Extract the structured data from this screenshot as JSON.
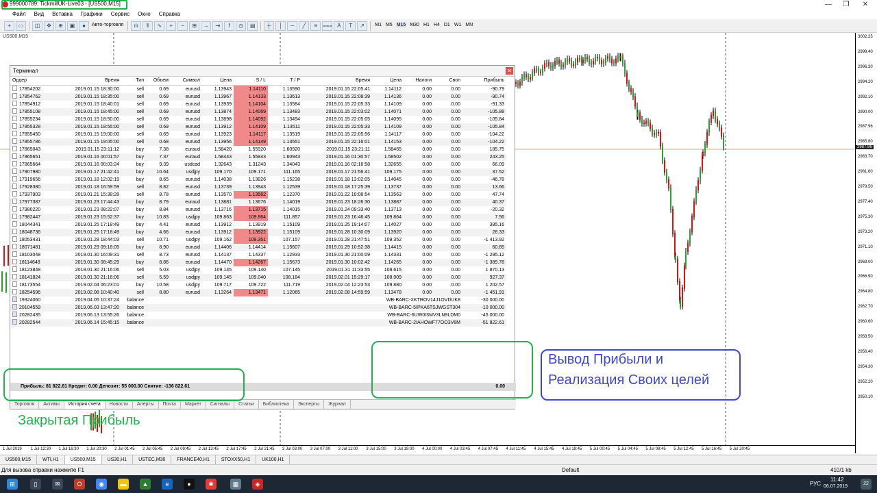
{
  "window": {
    "title": "999000789: TickmillUK-Live03 - [US500,M15]",
    "min": "—",
    "restore": "❐",
    "close": "✕"
  },
  "menu": [
    "Файл",
    "Вид",
    "Вставка",
    "Графики",
    "Сервис",
    "Окно",
    "Справка"
  ],
  "toolbar": {
    "autotrade": "Авто-торговля",
    "timeframes": [
      "M1",
      "M5",
      "M15",
      "M30",
      "H1",
      "H4",
      "D1",
      "W1",
      "MN"
    ]
  },
  "chart": {
    "symbol": "US500,M15",
    "prices": [
      "3002.25",
      "2998.40",
      "2996.30",
      "2994.20",
      "2992.10",
      "2990.00",
      "2987.96",
      "2985.80",
      "2983.70",
      "2981.60",
      "2979.50",
      "2977.40",
      "2975.30",
      "2973.20",
      "2971.10",
      "2969.00",
      "2966.90",
      "2964.80",
      "2962.70",
      "2960.60",
      "2958.50",
      "2956.40",
      "2954.30",
      "2952.20",
      "2950.10"
    ],
    "current_price": "2987.96",
    "times": [
      "1 Jul 2019",
      "1 Jul 12:30",
      "1 Jul 16:30",
      "1 Jul 20:30",
      "2 Jul 01:45",
      "2 Jul 05:45",
      "2 Jul 09:45",
      "2 Jul 13:45",
      "2 Jul 17:45",
      "2 Jul 21:45",
      "3 Jul 03:00",
      "3 Jul 07:00",
      "3 Jul 11:00",
      "3 Jul 15:00",
      "3 Jul 19:00",
      "4 Jul 00:00",
      "4 Jul 03:45",
      "4 Jul 07:45",
      "4 Jul 11:45",
      "4 Jul 15:45",
      "4 Jul 19:45",
      "5 Jul 00:45",
      "5 Jul 04:45",
      "5 Jul 08:45",
      "5 Jul 12:45",
      "5 Jul 16:45",
      "5 Jul 20:45"
    ]
  },
  "terminal": {
    "title": "Терминал",
    "close": "✕",
    "columns": [
      "Ордер",
      "Время",
      "Тип",
      "Объем",
      "Символ",
      "Цена",
      "S / L",
      "T / P",
      "Время",
      "Цена",
      "Налоги",
      "Своп",
      "Прибыль"
    ],
    "trades": [
      [
        "17854202",
        "2019.01.15 18:30:00",
        "sell",
        "0.69",
        "eurusd",
        "1.13943",
        "1.14110",
        "1.13590",
        "2019.01.15 22:05:41",
        "1.14112",
        "0.00",
        "0.00",
        "-90.79"
      ],
      [
        "17854762",
        "2019.01.15 18:35:00",
        "sell",
        "0.69",
        "eurusd",
        "1.13967",
        "1.14133",
        "1.13613",
        "2019.01.15 22:08:39",
        "1.14136",
        "0.00",
        "0.00",
        "-90.74"
      ],
      [
        "17854912",
        "2019.01.15 18:40:01",
        "sell",
        "0.69",
        "eurusd",
        "1.13939",
        "1.14104",
        "1.13584",
        "2019.01.15 22:05:33",
        "1.14109",
        "0.00",
        "0.00",
        "-91.33"
      ],
      [
        "17855108",
        "2019.01.15 18:45:00",
        "sell",
        "0.69",
        "eurusd",
        "1.13874",
        "1.14069",
        "1.13483",
        "2019.01.15 22:03:02",
        "1.14071",
        "0.00",
        "0.00",
        "-105.88"
      ],
      [
        "17855234",
        "2019.01.15 18:50:00",
        "sell",
        "0.69",
        "eurusd",
        "1.13898",
        "1.14092",
        "1.13494",
        "2019.01.15 22:05:05",
        "1.14095",
        "0.00",
        "0.00",
        "-105.84"
      ],
      [
        "17855328",
        "2019.01.15 18:55:00",
        "sell",
        "0.69",
        "eurusd",
        "1.13912",
        "1.14109",
        "1.13511",
        "2019.01.15 22:05:33",
        "1.14109",
        "0.00",
        "0.00",
        "-105.84"
      ],
      [
        "17855450",
        "2019.01.15 19:00:00",
        "sell",
        "0.69",
        "eurusd",
        "1.13923",
        "1.14117",
        "1.13519",
        "2019.01.15 22:05:56",
        "1.14117",
        "0.00",
        "0.00",
        "-104.22"
      ],
      [
        "17855786",
        "2019.01.15 19:05:00",
        "sell",
        "0.68",
        "eurusd",
        "1.13956",
        "1.14149",
        "1.13551",
        "2019.01.15 22:16:01",
        "1.14153",
        "0.00",
        "0.00",
        "-104.22"
      ],
      [
        "17865043",
        "2019.01.15 23:11:12",
        "buy",
        "7.38",
        "euraud",
        "1.58420",
        "1.55920",
        "1.60920",
        "2019.01.15 23:21:11",
        "1.58465",
        "0.00",
        "0.00",
        "185.75"
      ],
      [
        "17865651",
        "2019.01.16 00:01:57",
        "buy",
        "7.37",
        "euraud",
        "1.58443",
        "1.55943",
        "1.60943",
        "2019.01.16 01:30:57",
        "1.58502",
        "0.00",
        "0.00",
        "243.25"
      ],
      [
        "17865664",
        "2019.01.16 00:03:24",
        "buy",
        "9.39",
        "usdcad",
        "1.32643",
        "1.31243",
        "1.34043",
        "2019.01.16 02:16:58",
        "1.32655",
        "0.00",
        "0.00",
        "66.09"
      ],
      [
        "17907980",
        "2019.01.17 21:42:41",
        "buy",
        "10.64",
        "usdjpy",
        "109.170",
        "109.171",
        "111.165",
        "2019.01.17 21:56:41",
        "109.175",
        "0.00",
        "0.00",
        "37.52"
      ],
      [
        "17919656",
        "2019.01.18 12:02:19",
        "buy",
        "8.65",
        "eurusd",
        "1.14038",
        "1.13826",
        "1.15238",
        "2019.01.18 13:02:05",
        "1.14045",
        "0.00",
        "0.00",
        "-46.78"
      ],
      [
        "17928380",
        "2019.01.18 16:59:59",
        "sell",
        "8.82",
        "eurusd",
        "1.13739",
        "1.13943",
        "1.12539",
        "2019.01.18 17:25:39",
        "1.13737",
        "0.00",
        "0.00",
        "13.66"
      ],
      [
        "17937903",
        "2019.01.21 15:38:28",
        "sell",
        "8.78",
        "eurusd",
        "1.13570",
        "1.13562",
        "1.12370",
        "2019.01.22 10:08:54",
        "1.13563",
        "0.00",
        "0.00",
        "47.74"
      ],
      [
        "17977387",
        "2019.01.23 17:44:43",
        "buy",
        "8.79",
        "euraud",
        "1.13881",
        "1.13676",
        "1.14019",
        "2019.01.23 18:26:30",
        "1.13887",
        "0.00",
        "0.00",
        "40.37"
      ],
      [
        "17980220",
        "2019.01.23 08:22:07",
        "buy",
        "8.84",
        "eurusd",
        "1.13716",
        "1.13715",
        "1.14015",
        "2019.01.24 09:33:40",
        "1.13713",
        "0.00",
        "0.00",
        "-20.32"
      ],
      [
        "17982447",
        "2019.01.23 15:52:37",
        "buy",
        "10.83",
        "usdjpy",
        "109.863",
        "109.864",
        "111.857",
        "2019.01.23 16:46:45",
        "109.864",
        "0.00",
        "0.00",
        "7.56"
      ],
      [
        "18044341",
        "2019.01.25 17:18:49",
        "buy",
        "4.41",
        "eurusd",
        "1.13912",
        "1.13919",
        "1.15109",
        "2019.01.25 19:14:07",
        "1.14027",
        "0.00",
        "0.00",
        "385.16"
      ],
      [
        "18048736",
        "2019.01.25 17:18:49",
        "buy",
        "4.66",
        "eurusd",
        "1.13912",
        "1.13922",
        "1.15109",
        "2019.01.28 10:30:09",
        "1.13920",
        "0.00",
        "0.00",
        "28.33"
      ],
      [
        "18053431",
        "2019.01.28 18:44:03",
        "sell",
        "10.71",
        "usdjpy",
        "109.162",
        "109.351",
        "107.157",
        "2019.01.28 21:47:51",
        "109.352",
        "0.00",
        "0.00",
        "-1 413.92"
      ],
      [
        "18071481",
        "2019.01.29 09:18:05",
        "buy",
        "8.90",
        "eurusd",
        "1.14406",
        "1.14414",
        "1.15607",
        "2019.01.29 10:52:38",
        "1.14415",
        "0.00",
        "0.00",
        "60.85"
      ],
      [
        "18103048",
        "2019.01.30 16:09:31",
        "sell",
        "8.73",
        "eurusd",
        "1.14137",
        "1.14337",
        "1.12933",
        "2019.01.30 21:00:09",
        "1.14331",
        "0.00",
        "0.00",
        "-1 295.12"
      ],
      [
        "18114648",
        "2019.01.30 08:45:29",
        "buy",
        "8.86",
        "eurusd",
        "1.14470",
        "1.14267",
        "1.15673",
        "2019.01.30 10:02:42",
        "1.14265",
        "0.00",
        "0.00",
        "-1 389.78"
      ],
      [
        "18123848",
        "2019.01.30 21:16:06",
        "sell",
        "5.03",
        "usdjpy",
        "109.145",
        "109.140",
        "107.145",
        "2019.01.31 11:33:55",
        "108.615",
        "0.00",
        "0.00",
        "1 870.13"
      ],
      [
        "18141824",
        "2019.01.30 21:16:06",
        "sell",
        "5.59",
        "usdjpy",
        "109.145",
        "109.040",
        "108.184",
        "2019.02.01 15:29:17",
        "108.909",
        "0.00",
        "0.00",
        "927.37"
      ],
      [
        "18173554",
        "2019.02.04 06:23:01",
        "buy",
        "10.58",
        "usdjpy",
        "109.717",
        "109.722",
        "111.719",
        "2019.02.04 12:23:53",
        "109.880",
        "0.00",
        "0.00",
        "1 202.57"
      ],
      [
        "18254596",
        "2019.02.08 10:40:40",
        "sell",
        "8.80",
        "eurusd",
        "1.13264",
        "1.13471",
        "1.12065",
        "2019.02.08 14:59:59",
        "1.13478",
        "0.00",
        "0.00",
        "-1 451.91"
      ]
    ],
    "sl_highlight": [
      0,
      1,
      2,
      3,
      4,
      5,
      6,
      7,
      14,
      16,
      17,
      19,
      20,
      23,
      27
    ],
    "balances": [
      [
        "19324060",
        "2019.04.05 10:37:24",
        "balance",
        "WB-BARC-XKTROV14J1OVDUK8",
        "-30 000.00"
      ],
      [
        "20104559",
        "2019.06.03 13:47:20",
        "balance",
        "WB-BARC-5IPKA6TSJWGST304",
        "-10 000.00"
      ],
      [
        "20282435",
        "2019.06.13 13:55:26",
        "balance",
        "WB-BARC-6UW0I3MV3LN9LDM0",
        "-45 000.00"
      ],
      [
        "20282544",
        "2019.06.14 15:45:15",
        "balance",
        "WB-BARC-2IAHOWF77OO3V8M",
        "-51 822.61"
      ]
    ],
    "summary": "Прибыль: 81 822.61  Кредит: 0.00  Депозит: 55 000.00  Снятие: -136 822.61",
    "summary_value": "0.00",
    "tabs": [
      "Торговля",
      "Активы",
      "История счета",
      "Новости",
      "Алерты",
      "Почта",
      "Маркет",
      "Сигналы",
      "Статьи",
      "Библиотека",
      "Эксперты",
      "Журнал"
    ],
    "active_tab": 2
  },
  "symbol_tabs": [
    "US500,M15",
    "WTI,H1",
    "US500,M15",
    "US30,H1",
    "USTEC,M30",
    "FRANCE40,H1",
    "STOXX50,H1",
    "UK100,H1"
  ],
  "active_symbol_tab": 2,
  "status": {
    "help": "Для вызова справки нажмите F1",
    "profile": "Default",
    "traffic": "410/1 kb"
  },
  "taskbar": {
    "lang": "РУС",
    "time": "11:42",
    "date": "06.07.2019",
    "notif": "22"
  },
  "annotations": {
    "closed_profit": "Закрытая Прибыль",
    "line1": "Вывод Прибыли  и",
    "line2": "Реализация Своих целей"
  }
}
